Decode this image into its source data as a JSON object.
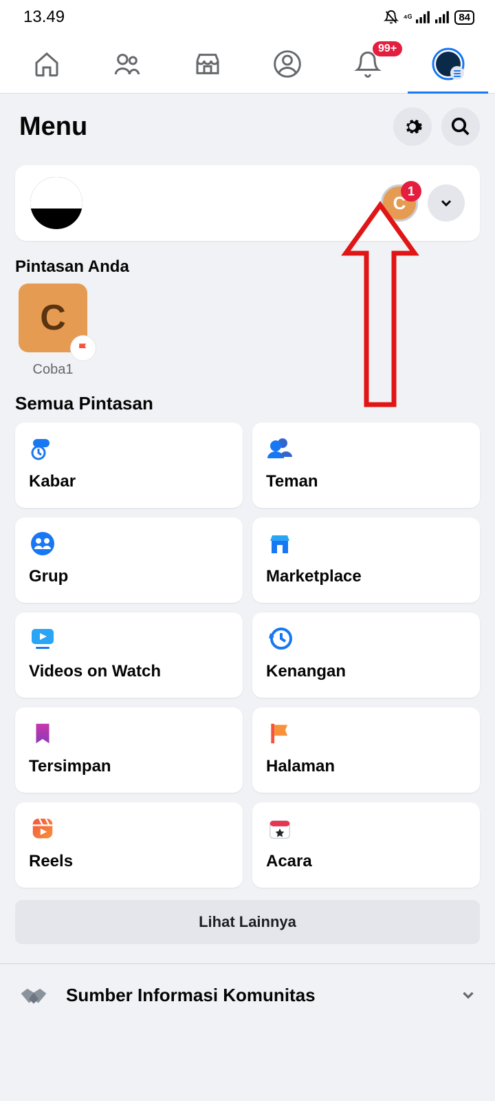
{
  "status": {
    "time": "13.49",
    "battery": "84"
  },
  "nav": {
    "notif_badge": "99+"
  },
  "header": {
    "title": "Menu"
  },
  "profile_card": {
    "page_initial": "C",
    "page_badge": "1"
  },
  "sections": {
    "shortcuts_title": "Pintasan Anda",
    "all_shortcuts_title": "Semua Pintasan"
  },
  "shortcuts": [
    {
      "initial": "C",
      "label": "Coba1"
    }
  ],
  "grid": [
    {
      "label": "Kabar"
    },
    {
      "label": "Teman"
    },
    {
      "label": "Grup"
    },
    {
      "label": "Marketplace"
    },
    {
      "label": "Videos on Watch"
    },
    {
      "label": "Kenangan"
    },
    {
      "label": "Tersimpan"
    },
    {
      "label": "Halaman"
    },
    {
      "label": "Reels"
    },
    {
      "label": "Acara"
    }
  ],
  "see_more_label": "Lihat Lainnya",
  "community_row_label": "Sumber Informasi Komunitas"
}
